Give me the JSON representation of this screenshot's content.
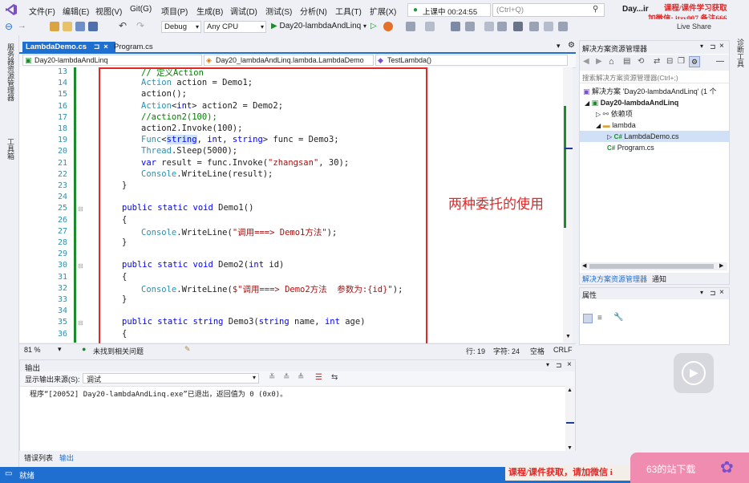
{
  "menubar": {
    "items": [
      "文件(F)",
      "编辑(E)",
      "视图(V)",
      "Git(G)",
      "项目(P)",
      "生成(B)",
      "调试(D)",
      "测试(S)",
      "分析(N)",
      "工具(T)",
      "扩展(X)"
    ],
    "upload_status": "上课中 00:24:55",
    "search_placeholder": "(Ctrl+Q)",
    "window_title": "Day...ir",
    "live_share": "Live Share"
  },
  "toolbar": {
    "config": "Debug",
    "platform": "Any CPU",
    "start_target": "Day20-lambdaAndLinq"
  },
  "left_strip": {
    "server_explorer": "服务器资源管理器",
    "toolbox": "工具箱"
  },
  "right_strip": {
    "diagnostics": "诊断工具"
  },
  "doc_tabs": [
    {
      "label": "LambdaDemo.cs",
      "active": true
    },
    {
      "label": "Program.cs",
      "active": false
    }
  ],
  "navbar": {
    "project": "Day20-lambdaAndLinq",
    "class": "Day20_lambdaAndLinq.lambda.LambdaDemo",
    "member": "TestLambda()"
  },
  "code_lines": [
    {
      "ln": "13",
      "code": "// 定义Action"
    },
    {
      "ln": "14",
      "code": "Action action = Demo1;"
    },
    {
      "ln": "15",
      "code": "action();"
    },
    {
      "ln": "16",
      "code": "Action<int> action2 = Demo2;"
    },
    {
      "ln": "17",
      "code": "//action2(100);"
    },
    {
      "ln": "18",
      "code": "action2.Invoke(100);"
    },
    {
      "ln": "19",
      "code": "Func<string, int, string> func = Demo3;"
    },
    {
      "ln": "20",
      "code": "Thread.Sleep(5000);"
    },
    {
      "ln": "21",
      "code": "var result = func.Invoke(\"zhangsan\", 30);"
    },
    {
      "ln": "22",
      "code": "Console.WriteLine(result);"
    },
    {
      "ln": "23",
      "code": "}"
    },
    {
      "ln": "24",
      "code": ""
    },
    {
      "ln": "25",
      "code": "public static void Demo1()"
    },
    {
      "ln": "26",
      "code": "{"
    },
    {
      "ln": "27",
      "code": "Console.WriteLine(\"调用===> Demo1方法\");"
    },
    {
      "ln": "28",
      "code": "}"
    },
    {
      "ln": "29",
      "code": ""
    },
    {
      "ln": "30",
      "code": "public static void Demo2(int id)"
    },
    {
      "ln": "31",
      "code": "{"
    },
    {
      "ln": "32",
      "code": "Console.WriteLine($\"调用===> Demo2方法  参数为:{id}\");"
    },
    {
      "ln": "33",
      "code": "}"
    },
    {
      "ln": "34",
      "code": ""
    },
    {
      "ln": "35",
      "code": "public static string Demo3(string name, int age)"
    },
    {
      "ln": "36",
      "code": "{"
    }
  ],
  "annotation": "两种委托的使用",
  "editor_status": {
    "zoom": "81 %",
    "issues": "未找到相关问题",
    "line": "行: 19",
    "char": "字符: 24",
    "whitespace": "空格",
    "eol": "CRLF"
  },
  "output": {
    "title": "输出",
    "source_label": "显示输出来源(S):",
    "source_value": "调试",
    "text": "程序“[20052] Day20-lambdaAndLinq.exe”已退出，返回值为 0 (0x0)。"
  },
  "bottom_tabs": [
    "错误列表",
    "输出"
  ],
  "statusbar": {
    "ready": "就绪"
  },
  "solution_explorer": {
    "title": "解决方案资源管理器",
    "search_placeholder": "搜索解决方案资源管理器(Ctrl+;)",
    "solution": "解决方案 'Day20-lambdaAndLinq' (1 个",
    "project": "Day20-lambdaAndLinq",
    "deps": "依赖项",
    "folder": "lambda",
    "file1": "LambdaDemo.cs",
    "file2": "Program.cs",
    "tab1": "解决方案资源管理器",
    "tab2": "通知"
  },
  "properties": {
    "title": "属性"
  },
  "watermark": {
    "line1": "课程/课件学习获取",
    "line2": "加微信: itzy007 备注666",
    "bottom": "课程/课件获取，请加微信 i"
  },
  "promo": {
    "text": "63的站下载"
  },
  "colors": {
    "accent": "#1e6fd0",
    "annotation": "#e32626",
    "keyword": "#0000ff",
    "type": "#2b91af",
    "comment": "#008000",
    "string": "#a31515"
  }
}
